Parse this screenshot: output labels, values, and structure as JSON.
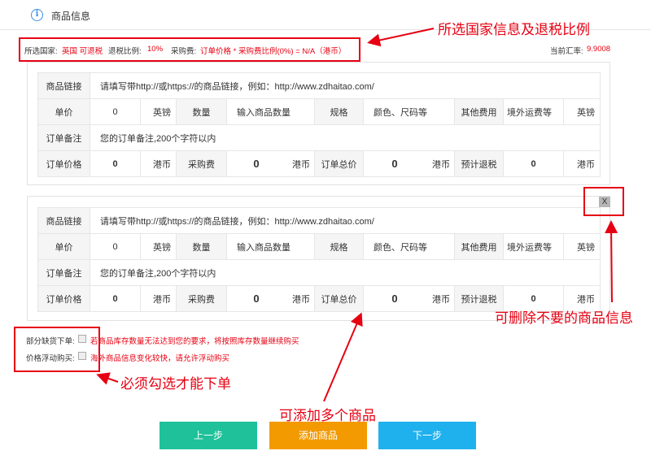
{
  "header": {
    "title": "商品信息",
    "icon": "info-icon"
  },
  "summary": {
    "country_label": "所选国家:",
    "country_value": "英国 可退税",
    "tax_label": "退税比例:",
    "tax_value": "10%",
    "fee_label": "采购费:",
    "fee_value": "订单价格 * 采购费比例(0%) = N/A（港币）",
    "rate_label": "当前汇率:",
    "rate_value": "9.9008"
  },
  "product_form": {
    "link_label": "商品链接",
    "link_placeholder": "请填写带http://或https://的商品链接，例如：http://www.zdhaitao.com/",
    "price_label": "单价",
    "price_value": "0",
    "price_unit": "英镑",
    "qty_label": "数量",
    "qty_placeholder": "输入商品数量",
    "spec_label": "规格",
    "spec_placeholder": "颜色、尺码等",
    "other_label": "其他费用",
    "other_placeholder": "境外运费等",
    "other_unit": "英镑",
    "note_label": "订单备注",
    "note_placeholder": "您的订单备注,200个字符以内",
    "order_price_label": "订单价格",
    "order_price_value": "0",
    "currency_unit": "港币",
    "purchase_fee_label": "采购费",
    "purchase_fee_value": "0",
    "total_label": "订单总价",
    "total_value": "0",
    "refund_label": "预计退税",
    "refund_value": "0"
  },
  "delete_button": "X",
  "options": {
    "partial_label": "部分缺货下单:",
    "partial_desc": "若商品库存数量无法达到您的要求，将按照库存数量继续购买",
    "float_label": "价格浮动购买:",
    "float_desc": "海外商品信息变化较快，请允许浮动购买"
  },
  "annotations": {
    "country_info": "所选国家信息及退税比例",
    "delete_info": "可删除不要的商品信息",
    "must_check": "必须勾选才能下单",
    "add_multiple": "可添加多个商品"
  },
  "buttons": {
    "prev": "上一步",
    "add": "添加商品",
    "next": "下一步"
  },
  "colors": {
    "red": "#e60012",
    "prev_btn": "#1ec19a",
    "add_btn": "#f39a00",
    "next_btn": "#1fb0ee",
    "info_blue": "#3a8ee6"
  }
}
